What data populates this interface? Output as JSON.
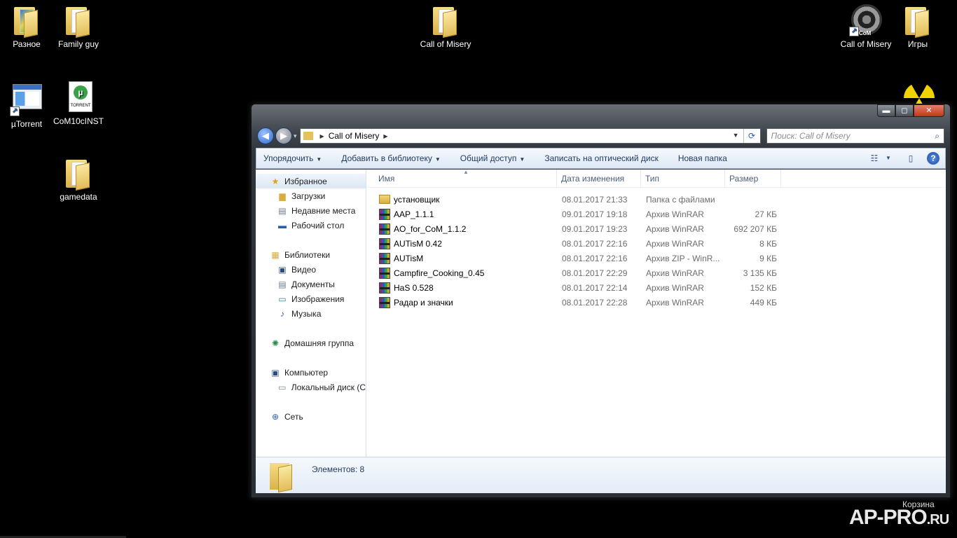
{
  "desktop": {
    "icons": [
      {
        "label": "Разное"
      },
      {
        "label": "Family guy"
      },
      {
        "label": "µTorrent"
      },
      {
        "label": "CoM10cINST"
      },
      {
        "label": "gamedata"
      },
      {
        "label": "Call of Misery"
      },
      {
        "label": "Call of Misery"
      },
      {
        "label": "Игры"
      }
    ],
    "torrent_badge": "TORRENT",
    "com_badge": "CoM",
    "recycle_bin": "Корзина",
    "watermark": "AP-PRO",
    "watermark_suffix": ".RU"
  },
  "window": {
    "controls": {
      "minimize": "▬",
      "maximize": "◻",
      "close": "✕"
    },
    "nav": {
      "back": "◀",
      "forward": "▶",
      "history": "▾"
    },
    "address": {
      "path": "Call of Misery"
    },
    "search": {
      "placeholder": "Поиск: Call of Misery"
    },
    "toolbar": {
      "organize": "Упорядочить",
      "add_library": "Добавить в библиотеку",
      "share": "Общий доступ",
      "burn": "Записать на оптический диск",
      "new_folder": "Новая папка"
    },
    "sidebar": {
      "favorites": "Избранное",
      "downloads": "Загрузки",
      "recent": "Недавние места",
      "desktop": "Рабочий стол",
      "libraries": "Библиотеки",
      "video": "Видео",
      "documents": "Документы",
      "pictures": "Изображения",
      "music": "Музыка",
      "homegroup": "Домашняя группа",
      "computer": "Компьютер",
      "local_disk": "Локальный диск (C",
      "network": "Сеть"
    },
    "columns": {
      "name": "Имя",
      "date": "Дата изменения",
      "type": "Тип",
      "size": "Размер"
    },
    "files": [
      {
        "name": "установщик",
        "date": "08.01.2017 21:33",
        "type": "Папка с файлами",
        "size": "",
        "kind": "folder"
      },
      {
        "name": "AAP_1.1.1",
        "date": "09.01.2017 19:18",
        "type": "Архив WinRAR",
        "size": "27 КБ",
        "kind": "rar"
      },
      {
        "name": "AO_for_CoM_1.1.2",
        "date": "09.01.2017 19:23",
        "type": "Архив WinRAR",
        "size": "692 207 КБ",
        "kind": "rar"
      },
      {
        "name": "AUTisM 0.42",
        "date": "08.01.2017 22:16",
        "type": "Архив WinRAR",
        "size": "8 КБ",
        "kind": "rar"
      },
      {
        "name": "AUTisM",
        "date": "08.01.2017 22:16",
        "type": "Архив ZIP - WinR...",
        "size": "9 КБ",
        "kind": "rar"
      },
      {
        "name": "Campfire_Cooking_0.45",
        "date": "08.01.2017 22:29",
        "type": "Архив WinRAR",
        "size": "3 135 КБ",
        "kind": "rar"
      },
      {
        "name": "HaS 0.528",
        "date": "08.01.2017 22:14",
        "type": "Архив WinRAR",
        "size": "152 КБ",
        "kind": "rar"
      },
      {
        "name": "Радар и значки",
        "date": "08.01.2017 22:28",
        "type": "Архив WinRAR",
        "size": "449 КБ",
        "kind": "rar"
      }
    ],
    "status": {
      "count": "Элементов: 8"
    }
  }
}
